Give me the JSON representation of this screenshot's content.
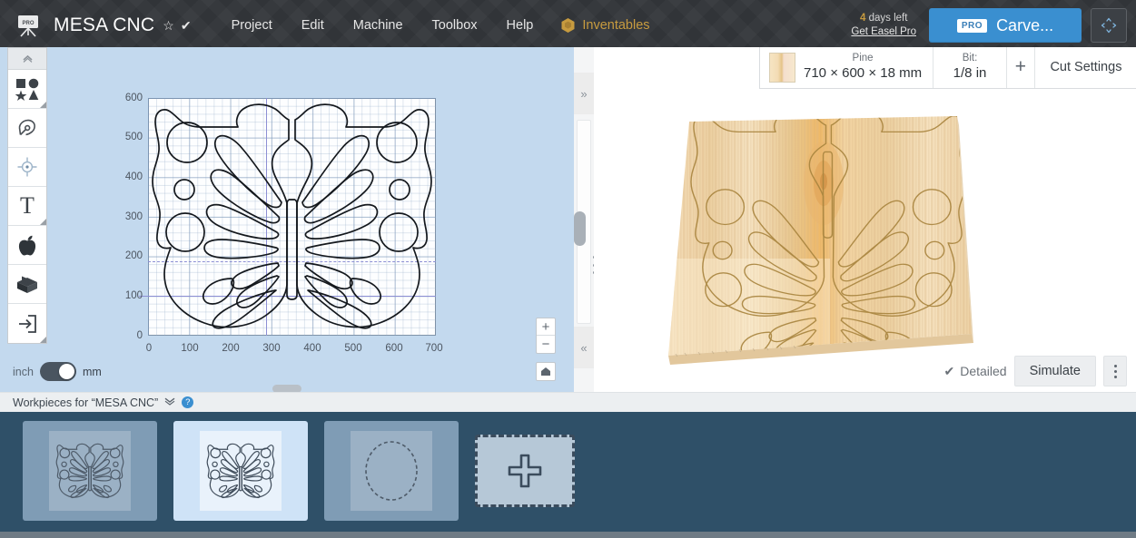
{
  "header": {
    "logo_icon": "easel-pro-logo",
    "logo_badge": "PRO",
    "project_title": "MESA CNC",
    "star_icon": "☆",
    "check_icon": "✔",
    "menu": [
      {
        "label": "Project"
      },
      {
        "label": "Edit"
      },
      {
        "label": "Machine"
      },
      {
        "label": "Toolbox"
      },
      {
        "label": "Help"
      }
    ],
    "inventables": {
      "label": "Inventables",
      "icon": "inventables-hex-icon",
      "color": "#c79b3f"
    },
    "trial": {
      "days": "4",
      "days_suffix": "days left",
      "link": "Get Easel Pro"
    },
    "carve_button": {
      "badge": "PRO",
      "label": "Carve...",
      "color": "#3a8fd0"
    },
    "fullscreen_icon": "expand-arrows-icon"
  },
  "toolbar": {
    "collapse_icon": "chevron-up-icon",
    "items": [
      {
        "name": "shapes-tool",
        "icon": "shapes-icon"
      },
      {
        "name": "pen-tool",
        "icon": "pen-nib-icon"
      },
      {
        "name": "center-tool",
        "icon": "crosshair-icon"
      },
      {
        "name": "text-tool",
        "icon": "text-t-icon",
        "label": "T"
      },
      {
        "name": "apps-tool",
        "icon": "apple-icon"
      },
      {
        "name": "models-tool",
        "icon": "box-icon"
      },
      {
        "name": "import-tool",
        "icon": "import-arrow-icon"
      }
    ]
  },
  "canvas": {
    "units": {
      "left_label": "inch",
      "right_label": "mm",
      "selected": "mm"
    },
    "y_ticks": [
      "600",
      "500",
      "400",
      "300",
      "200",
      "100",
      "0"
    ],
    "x_ticks": [
      "0",
      "100",
      "200",
      "300",
      "400",
      "500",
      "600",
      "700"
    ],
    "zoom_in": "+",
    "zoom_out": "−",
    "home_icon": "home-icon",
    "design_name": "butterfly-outline"
  },
  "divider": {
    "expand_right_icon": "»",
    "collapse_left_icon": "«"
  },
  "material_bar": {
    "swatch_name": "pine-swatch",
    "material_label": "Pine",
    "dimensions": "710 × 600 × 18 mm",
    "bit_label": "Bit:",
    "bit_value": "1/8 in",
    "add_label": "+",
    "cut_settings_label": "Cut Settings"
  },
  "preview": {
    "detailed_label": "Detailed",
    "detailed_check": "✔",
    "simulate_label": "Simulate",
    "more_icon": "kebab-menu-icon"
  },
  "workpieces": {
    "header_label": "Workpieces for “MESA CNC”",
    "chevron_icon": "chevron-double-down-icon",
    "help_icon": "?",
    "tiles": [
      {
        "name": "workpiece-butterfly-1",
        "shape": "butterfly",
        "selected": false
      },
      {
        "name": "workpiece-butterfly-2",
        "shape": "butterfly",
        "selected": true
      },
      {
        "name": "workpiece-circle",
        "shape": "circle",
        "selected": false
      }
    ],
    "add_tile": {
      "name": "add-workpiece",
      "icon": "plus-icon"
    }
  }
}
